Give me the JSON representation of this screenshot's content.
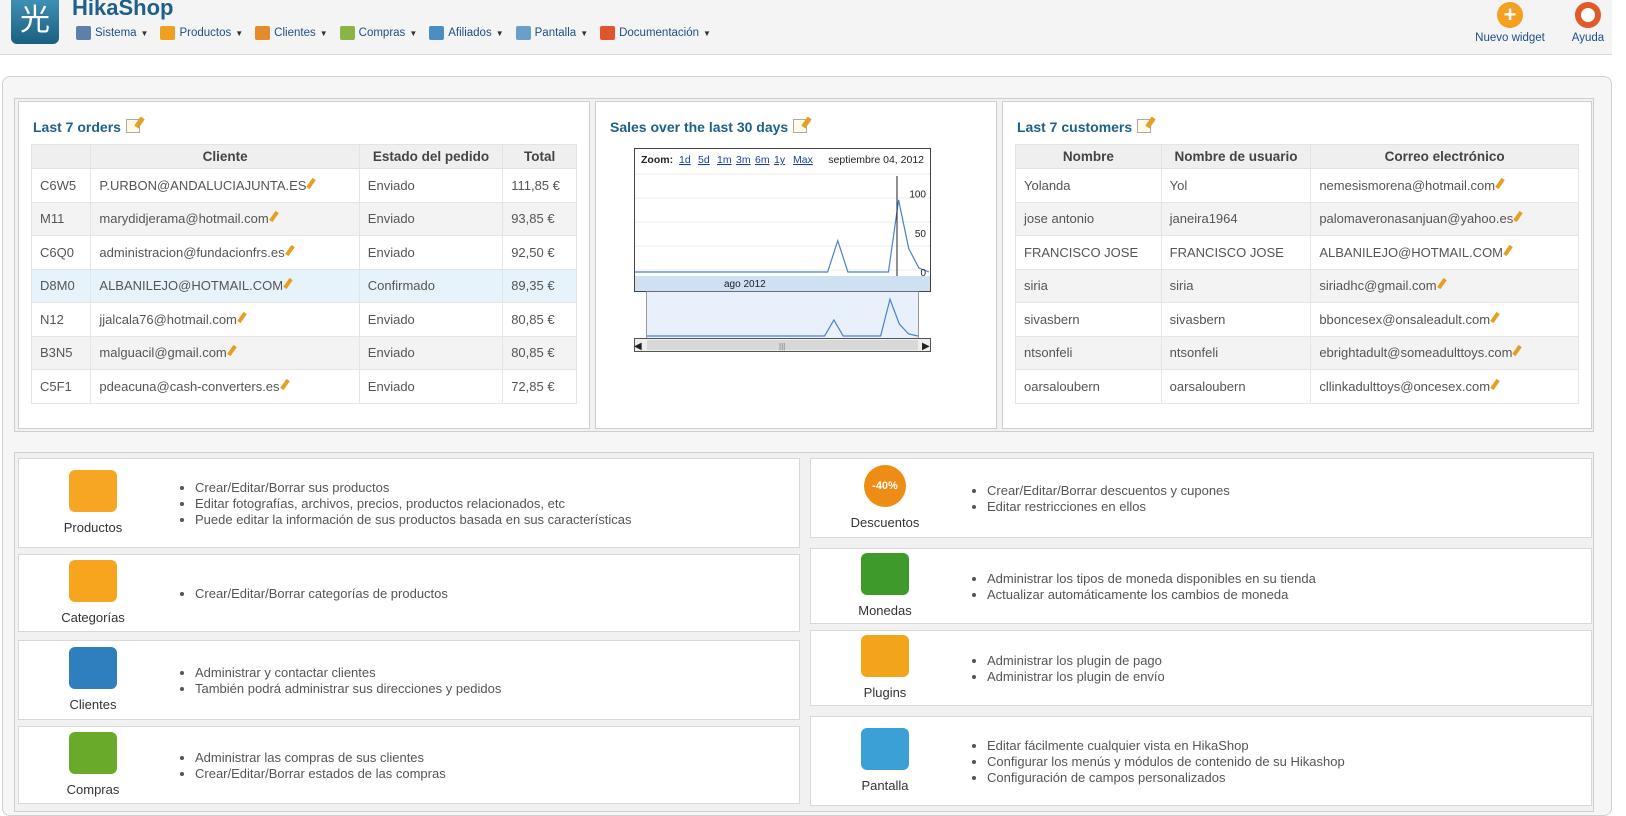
{
  "app": {
    "logo_glyph": "光",
    "name": "HikaShop"
  },
  "menu": [
    {
      "label": "Sistema",
      "icon": "wrench-icon",
      "color": "#5d7fa8"
    },
    {
      "label": "Productos",
      "icon": "box-icon",
      "color": "#f0a020"
    },
    {
      "label": "Clientes",
      "icon": "users-icon",
      "color": "#e68a2e"
    },
    {
      "label": "Compras",
      "icon": "clipboard-icon",
      "color": "#8ab34a"
    },
    {
      "label": "Afiliados",
      "icon": "affiliates-icon",
      "color": "#4d8ec0"
    },
    {
      "label": "Pantalla",
      "icon": "display-icon",
      "color": "#6aa0c8"
    },
    {
      "label": "Documentación",
      "icon": "lifebuoy-icon",
      "color": "#e0552d"
    }
  ],
  "tools": {
    "new_widget": {
      "label": "Nuevo widget",
      "icon": "plus-icon",
      "color": "#f4a020"
    },
    "help": {
      "label": "Ayuda",
      "icon": "lifebuoy-icon",
      "color": "#e05a2a"
    }
  },
  "orders": {
    "title": "Last 7 orders",
    "headers": [
      "",
      "Cliente",
      "Estado del pedido",
      "Total"
    ],
    "rows": [
      {
        "code": "C6W5",
        "client": "P.URBON@ANDALUCIAJUNTA.ES",
        "status": "Enviado",
        "total": "111,85 €"
      },
      {
        "code": "M11",
        "client": "marydidjerama@hotmail.com",
        "status": "Enviado",
        "total": "93,85 €"
      },
      {
        "code": "C6Q0",
        "client": "administracion@fundacionfrs.es",
        "status": "Enviado",
        "total": "92,50 €"
      },
      {
        "code": "D8M0",
        "client": "ALBANILEJO@HOTMAIL.COM",
        "status": "Confirmado",
        "total": "89,35 €"
      },
      {
        "code": "N12",
        "client": "jjalcala76@hotmail.com",
        "status": "Enviado",
        "total": "80,85 €"
      },
      {
        "code": "B3N5",
        "client": "malguacil@gmail.com",
        "status": "Enviado",
        "total": "80,85 €"
      },
      {
        "code": "C5F1",
        "client": "pdeacuna@cash-converters.es",
        "status": "Enviado",
        "total": "72,85 €"
      }
    ]
  },
  "sales": {
    "title": "Sales over the last 30 days",
    "zoom_label": "Zoom:",
    "zoom_options": [
      "1d",
      "5d",
      "1m",
      "3m",
      "6m",
      "1y",
      "Max"
    ],
    "date_label": "septiembre 04, 2012",
    "month_label": "ago 2012",
    "scrollbar_grip": "|||"
  },
  "chart_data": {
    "type": "line",
    "title": "Sales over the last 30 days",
    "x": [
      "2012-08-06",
      "2012-08-07",
      "2012-08-08",
      "2012-08-09",
      "2012-08-10",
      "2012-08-11",
      "2012-08-12",
      "2012-08-13",
      "2012-08-14",
      "2012-08-15",
      "2012-08-16",
      "2012-08-17",
      "2012-08-18",
      "2012-08-19",
      "2012-08-20",
      "2012-08-21",
      "2012-08-22",
      "2012-08-23",
      "2012-08-24",
      "2012-08-25",
      "2012-08-26",
      "2012-08-27",
      "2012-08-28",
      "2012-08-29",
      "2012-08-30",
      "2012-08-31",
      "2012-09-01",
      "2012-09-02",
      "2012-09-03",
      "2012-09-04"
    ],
    "values": [
      0,
      0,
      0,
      0,
      0,
      0,
      0,
      0,
      0,
      0,
      0,
      0,
      0,
      0,
      0,
      0,
      0,
      0,
      0,
      0,
      40,
      0,
      0,
      0,
      0,
      0,
      92,
      30,
      5,
      0
    ],
    "ylim": [
      0,
      120
    ],
    "yticks": [
      "100",
      "50",
      "0"
    ],
    "navigator_values": [
      0,
      0,
      0,
      0,
      0,
      0,
      0,
      0,
      0,
      0,
      0,
      0,
      0,
      0,
      0,
      0,
      0,
      0,
      0,
      0,
      40,
      0,
      0,
      0,
      0,
      0,
      92,
      30,
      5,
      0
    ]
  },
  "customers": {
    "title": "Last 7 customers",
    "headers": [
      "Nombre",
      "Nombre de usuario",
      "Correo electrónico"
    ],
    "rows": [
      {
        "name": "Yolanda",
        "user": "Yol",
        "email": "nemesismorena@hotmail.com"
      },
      {
        "name": "jose antonio",
        "user": "janeira1964",
        "email": "palomaveronasanjuan@yahoo.es"
      },
      {
        "name": "FRANCISCO JOSE",
        "user": "FRANCISCO JOSE",
        "email": "ALBANILEJO@HOTMAIL.COM"
      },
      {
        "name": "siria",
        "user": "siria",
        "email": "siriadhc@gmail.com"
      },
      {
        "name": "sivasbern",
        "user": "sivasbern",
        "email": "bboncesex@onsaleadult.com"
      },
      {
        "name": "ntsonfeli",
        "user": "ntsonfeli",
        "email": "ebrightadult@someadulttoys.com"
      },
      {
        "name": "oarsaloubern",
        "user": "oarsaloubern",
        "email": "cllinkadulttoys@oncesex.com"
      }
    ]
  },
  "cpanel_left": [
    {
      "label": "Productos",
      "icon": "products-box-icon",
      "color": "#f6a623",
      "items": [
        "Crear/Editar/Borrar sus productos",
        "Editar fotografías, archivos, precios, productos relacionados, etc",
        "Puede editar la información de sus productos basada en sus características"
      ]
    },
    {
      "label": "Categorías",
      "icon": "folder-icon",
      "color": "#f7a51f",
      "items": [
        "Crear/Editar/Borrar categorías de productos"
      ]
    },
    {
      "label": "Clientes",
      "icon": "customers-icon",
      "color": "#2f7fbf",
      "items": [
        "Administrar y contactar clientes",
        "También podrá administrar sus direcciones y pedidos"
      ]
    },
    {
      "label": "Compras",
      "icon": "orders-check-icon",
      "color": "#6aaa2a",
      "items": [
        "Administrar las compras de sus clientes",
        "Crear/Editar/Borrar estados de las compras"
      ]
    }
  ],
  "cpanel_right": [
    {
      "label": "Descuentos",
      "icon": "discount-badge-icon",
      "color": "#ee8d16",
      "badge": "-40%",
      "items": [
        "Crear/Editar/Borrar descuentos y cupones",
        "Editar restricciones en ellos"
      ]
    },
    {
      "label": "Monedas",
      "icon": "currency-icon",
      "color": "#3d9a2b",
      "items": [
        "Administrar los tipos de moneda disponibles en su tienda",
        "Actualizar automáticamente los cambios de moneda"
      ]
    },
    {
      "label": "Plugins",
      "icon": "plug-icon",
      "color": "#f2a51c",
      "items": [
        "Administrar los plugin de pago",
        "Administrar los plugin de envío"
      ]
    },
    {
      "label": "Pantalla",
      "icon": "window-icon",
      "color": "#3aa0d5",
      "items": [
        "Editar fácilmente cualquier vista en HikaShop",
        "Configurar los menús y módulos de contenido de su Hikashop",
        "Configuración de campos personalizados"
      ]
    }
  ]
}
